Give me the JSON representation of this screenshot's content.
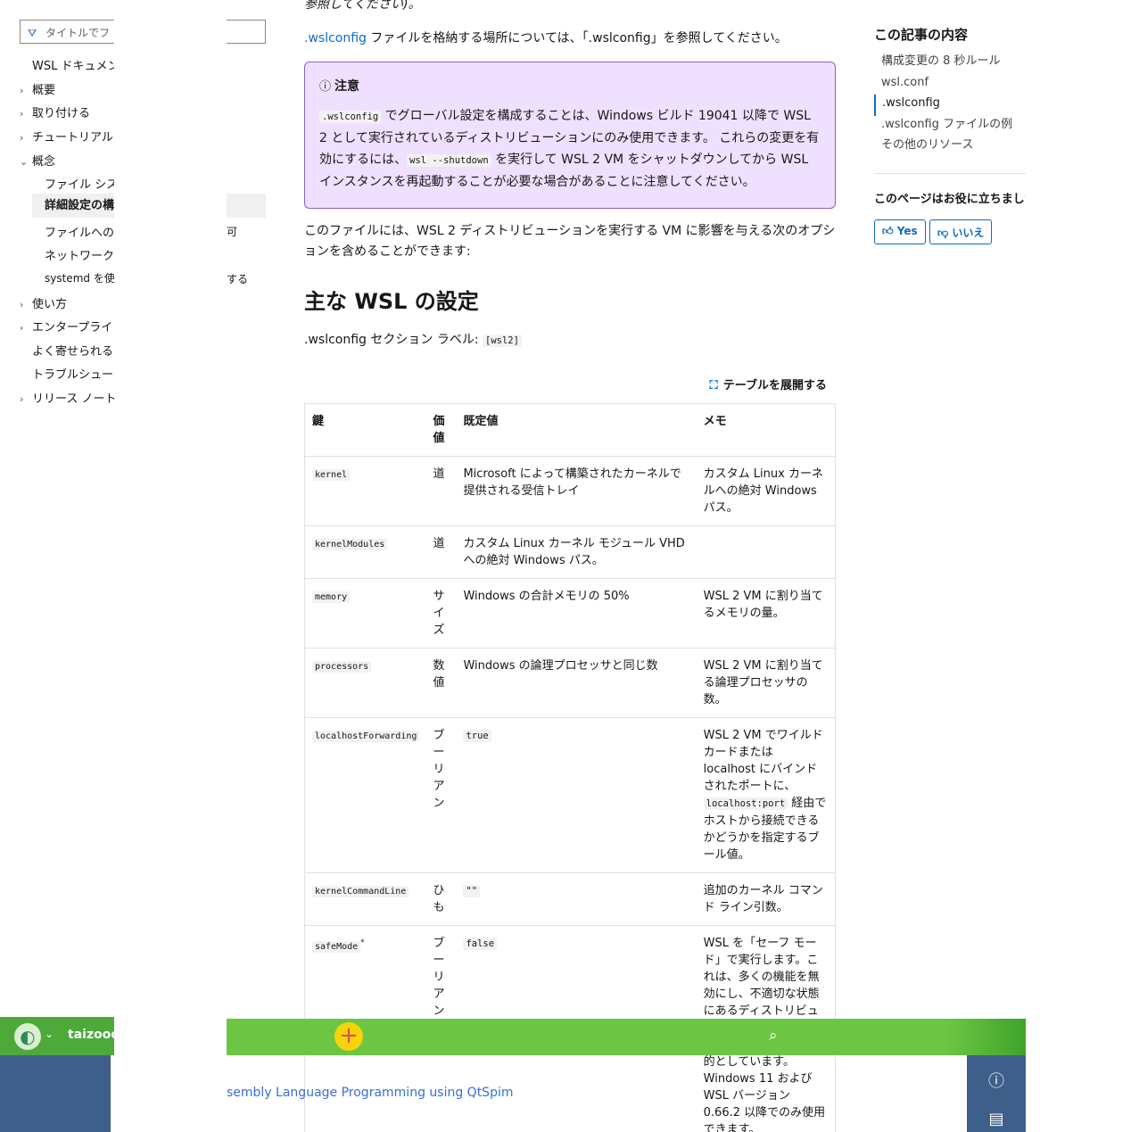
{
  "leftnav": {
    "filter_placeholder": "タイトルでフ",
    "items": [
      {
        "label": "WSL ドキュメン",
        "chev": ""
      },
      {
        "label": "概要",
        "chev": "›"
      },
      {
        "label": "取り付ける",
        "chev": "›"
      },
      {
        "label": "チュートリアル",
        "chev": "›"
      },
      {
        "label": "概念",
        "chev": "⌄"
      },
      {
        "label": "ファイル シス",
        "chev": ""
      },
      {
        "label": "詳細設定の構",
        "chev": ""
      },
      {
        "label": "ファイルへの",
        "chev": ""
      },
      {
        "label": "ネットワーク",
        "chev": ""
      },
      {
        "label": "systemd を使",
        "chev": ""
      },
      {
        "label": "使い方",
        "chev": "›"
      },
      {
        "label": "エンタープライ",
        "chev": "›"
      },
      {
        "label": "よく寄せられる",
        "chev": ""
      },
      {
        "label": "トラブルシュー",
        "chev": ""
      },
      {
        "label": "リリース ノート",
        "chev": "›"
      }
    ],
    "spill1": "可",
    "spill2": "する"
  },
  "main": {
    "top_fragment": "参照してください)。",
    "location_link": ".wslconfig",
    "location_text": " ファイルを格納する場所については、「.wslconfig」を参照してください。",
    "note_title": "注意",
    "note_code1": ".wslconfig",
    "note_text1": " でグローバル設定を構成することは、Windows ビルド 19041 以降で WSL 2 として実行されているディストリビューションにのみ使用できます。 これらの変更を有効にするには、",
    "note_code2": "wsl --shutdown",
    "note_text2": " を実行して WSL 2 VM をシャットダウンしてから WSL インスタンスを再起動することが必要な場合があることに注意してください。",
    "intro": "このファイルには、WSL 2 ディストリビューションを実行する VM に影響を与える次のオプションを含めることができます:",
    "h2": "主な WSL の設定",
    "section_label": ".wslconfig セクション ラベル: ",
    "section_code": "[wsl2]",
    "expand_label": "テーブルを展開する",
    "table": {
      "headers": [
        "鍵",
        "価値",
        "既定値",
        "メモ"
      ],
      "rows": [
        {
          "key": "kernel",
          "type": "道",
          "default": "Microsoft によって構築されたカーネルで提供される受信トレイ",
          "default_code": "",
          "note": "カスタム Linux カーネルへの絶対 Windows パス。"
        },
        {
          "key": "kernelModules",
          "type": "道",
          "default": "カスタム Linux カーネル モジュール VHD への絶対 Windows パス。",
          "default_code": "",
          "note": ""
        },
        {
          "key": "memory",
          "type": "サイズ",
          "default": "Windows の合計メモリの 50%",
          "default_code": "",
          "note": "WSL 2 VM に割り当てるメモリの量。"
        },
        {
          "key": "processors",
          "type": "数値",
          "default": "Windows の論理プロセッサと同じ数",
          "default_code": "",
          "note": "WSL 2 VM に割り当てる論理プロセッサの数。"
        },
        {
          "key": "localhostForwarding",
          "type": "ブーリアン",
          "default": "",
          "default_code": "true",
          "note": "WSL 2 VM でワイルドカードまたは localhost にバインドされたポートに、",
          "note_code": "localhost:port",
          "note_tail": " 経由でホストから接続できるかどうかを指定するブール値。"
        },
        {
          "key": "kernelCommandLine",
          "type": "ひも",
          "default": "",
          "default_code": "\"\"",
          "note": "追加のカーネル コマンド ライン引数。"
        },
        {
          "key": "safeMode",
          "key_sup": "*",
          "type": "ブーリアン",
          "default": "",
          "default_code": "false",
          "note": "WSL を「セーフ モード」で実行します。これは、多くの機能を無効にし、不適切な状態にあるディストリビューションを回復するために使用することを目的としています。Windows 11 および WSL バージョン 0.66.2 以降でのみ使用できます。"
        }
      ]
    }
  },
  "toc": {
    "title": "この記事の内容",
    "items": [
      "構成変更の 8 秒ルール",
      "wsl.conf",
      ".wslconfig",
      ".wslconfig ファイルの例",
      "その他のリソース"
    ],
    "helpful": "このページはお役に立ちましたか",
    "yes": "Yes",
    "no": "いいえ"
  },
  "bottom": {
    "username": "taizooo",
    "link": "sembly Language Programming using QtSpim",
    "accent_green": "#6cc644",
    "accent_blue": "#3e5f8a"
  }
}
